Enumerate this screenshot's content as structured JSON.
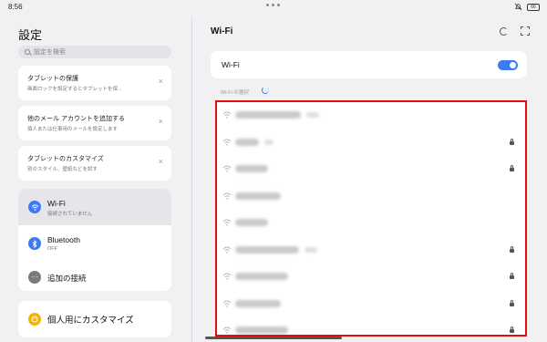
{
  "status_bar": {
    "time": "8:56",
    "battery": "66"
  },
  "left": {
    "title": "設定",
    "search_placeholder": "設定を検索",
    "cards": [
      {
        "title": "タブレットの保護",
        "subtitle": "画面ロックを設定するとタブレットを保..."
      },
      {
        "title": "他のメール アカウントを追加する",
        "subtitle": "個人または仕事用のメールを設定します"
      },
      {
        "title": "タブレットのカスタマイズ",
        "subtitle": "別のスタイル、壁紙などを試す"
      }
    ],
    "group": [
      {
        "title": "Wi-Fi",
        "subtitle": "接続されていません",
        "icon": "wifi-icon",
        "color": "#3d7cf0"
      },
      {
        "title": "Bluetooth",
        "subtitle": "OFF",
        "icon": "bluetooth-icon",
        "color": "#3d7cf0"
      },
      {
        "title": "追加の接続",
        "subtitle": "",
        "icon": "more-icon",
        "color": "#7a7a80"
      }
    ],
    "personalize": {
      "label": "個人用にカスタマイズ",
      "icon": "palette-icon",
      "color": "#f0b400"
    }
  },
  "right": {
    "title": "Wi-Fi",
    "wifi_toggle": {
      "label": "Wi-Fi",
      "on": true
    },
    "select_label": "Wi-Fi の選択",
    "networks": [
      {
        "locked": false
      },
      {
        "locked": true
      },
      {
        "locked": true
      },
      {
        "locked": false
      },
      {
        "locked": false
      },
      {
        "locked": true
      },
      {
        "locked": true
      },
      {
        "locked": true
      },
      {
        "locked": true
      }
    ]
  },
  "colors": {
    "accent": "#3d7cf0",
    "highlight_border": "#e01010"
  }
}
